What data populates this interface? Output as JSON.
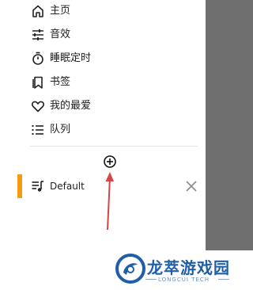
{
  "menu": {
    "items": [
      {
        "label": "主页",
        "icon": "home-icon"
      },
      {
        "label": "音效",
        "icon": "equalizer-icon"
      },
      {
        "label": "睡眠定时",
        "icon": "timer-icon"
      },
      {
        "label": "书签",
        "icon": "bookmark-icon"
      },
      {
        "label": "我的最爱",
        "icon": "heart-icon"
      },
      {
        "label": "队列",
        "icon": "queue-list-icon"
      }
    ]
  },
  "queues": {
    "add_icon": "add-circle-icon",
    "items": [
      {
        "label": "Default",
        "icon": "playlist-music-icon",
        "close_icon": "close-icon",
        "accent_color": "#f39c12"
      }
    ]
  },
  "annotation": {
    "arrow_color": "#d64545"
  },
  "watermark": {
    "title": "龙萃游戏园",
    "subtitle": "LONGCUI TECH"
  }
}
